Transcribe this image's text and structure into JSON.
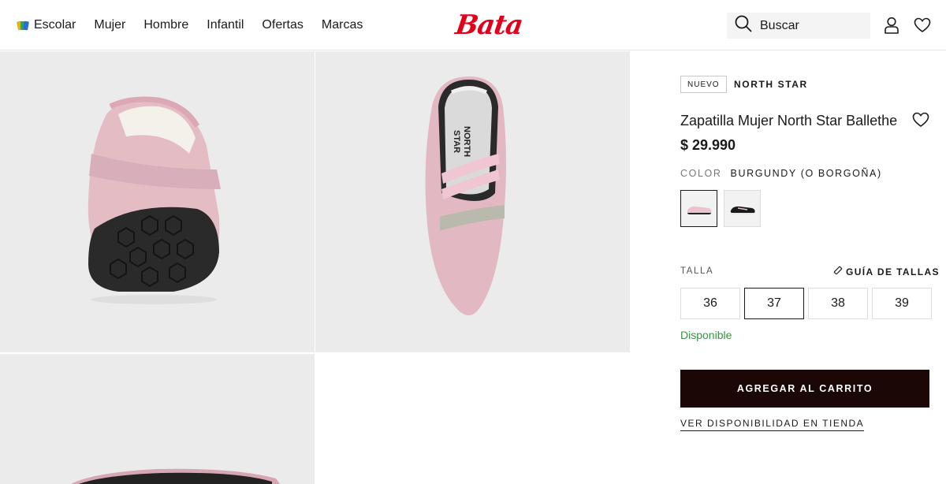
{
  "nav": {
    "items": [
      {
        "label": "Escolar",
        "icon": "books-icon"
      },
      {
        "label": "Mujer"
      },
      {
        "label": "Hombre"
      },
      {
        "label": "Infantil"
      },
      {
        "label": "Ofertas"
      },
      {
        "label": "Marcas"
      }
    ]
  },
  "logo": {
    "text": "Bata",
    "color": "#e2001a"
  },
  "search": {
    "placeholder": "Buscar"
  },
  "gallery": {
    "images": [
      {
        "alt": "Vista trasera de la zapatilla rosa"
      },
      {
        "alt": "Vista superior de la zapatilla rosa"
      },
      {
        "alt": "Vista de la suela de la zapatilla"
      }
    ]
  },
  "product": {
    "badge": "NUEVO",
    "brand": "NORTH STAR",
    "title": "Zapatilla Mujer North Star Ballethe",
    "price": "$ 29.990",
    "color_label": "COLOR",
    "color_value": "BURGUNDY (O BORGOÑA)",
    "swatches": [
      {
        "name": "rosa",
        "color": "#e9c4cc",
        "selected": true
      },
      {
        "name": "negro",
        "color": "#1a1a1a",
        "selected": false
      }
    ],
    "size_label": "TALLA",
    "size_guide": "GUÍA DE TALLAS",
    "sizes": [
      {
        "label": "36",
        "selected": false
      },
      {
        "label": "37",
        "selected": true
      },
      {
        "label": "38",
        "selected": false
      },
      {
        "label": "39",
        "selected": false
      }
    ],
    "availability": "Disponible",
    "add_to_cart": "AGREGAR AL CARRITO",
    "store_availability": "VER DISPONIBILIDAD EN TIENDA"
  },
  "colors": {
    "cart_button": "#1c0707",
    "available": "#2f9a3c",
    "gallery_bg": "#ebebeb"
  }
}
